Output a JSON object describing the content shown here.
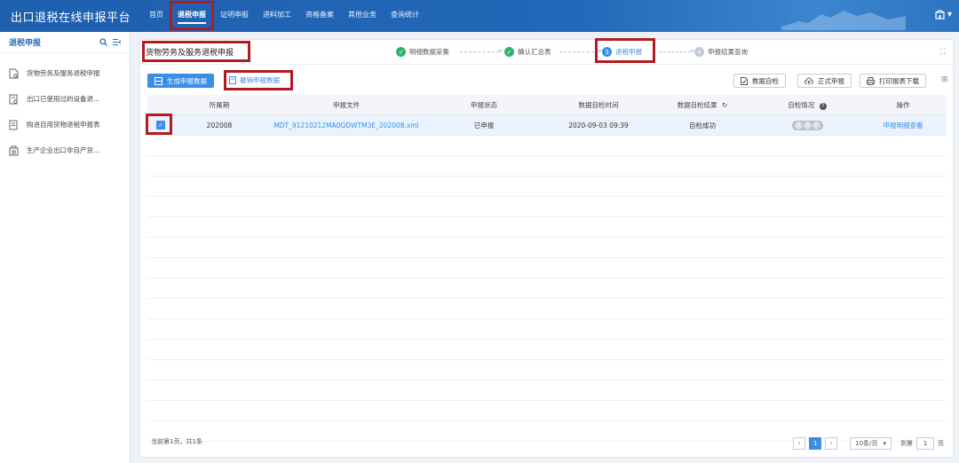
{
  "app": {
    "title": "出口退税在线申报平台"
  },
  "nav": {
    "items": [
      {
        "label": "首页"
      },
      {
        "label": "退税申报"
      },
      {
        "label": "证明申报"
      },
      {
        "label": "进料加工"
      },
      {
        "label": "资格备案"
      },
      {
        "label": "其他业务"
      },
      {
        "label": "查询统计"
      }
    ],
    "active_index": 1
  },
  "sidebar": {
    "title": "退税申报",
    "items": [
      {
        "label": "货物劳务及服务退税申报"
      },
      {
        "label": "出口已使用过的设备退..."
      },
      {
        "label": "购进自用货物退税申报表"
      },
      {
        "label": "生产企业出口非自产货..."
      }
    ]
  },
  "page": {
    "title": "货物劳务及服务退税申报",
    "steps": [
      {
        "label": "明细数据采集",
        "state": "done",
        "num": "1"
      },
      {
        "label": "确认汇总表",
        "state": "done",
        "num": "2"
      },
      {
        "label": "退税申报",
        "state": "current",
        "num": "3"
      },
      {
        "label": "申报结果查询",
        "state": "todo",
        "num": "4"
      }
    ]
  },
  "toolbar": {
    "generate_label": "生成申报数据",
    "revoke_label": "撤销申报数据",
    "self_check_label": "数据自检",
    "formal_label": "正式申报",
    "print_label": "打印报表下载"
  },
  "table": {
    "headers": [
      "所属期",
      "申报文件",
      "申报状态",
      "数据自检时间",
      "数据自检结果",
      "自检情况",
      "操作"
    ],
    "rows": [
      {
        "period": "202008",
        "file": "MDT_91210212MA0QDWTM3E_202008.xml",
        "status": "已申报",
        "check_time": "2020-09-03 09:39",
        "check_result": "自检成功",
        "check_counts": [
          "0",
          "0",
          "0"
        ],
        "action": "申报明细查看"
      }
    ]
  },
  "footer": {
    "info": "当前第1页，共1条",
    "current_page": "1",
    "page_size": "10条/页",
    "goto_label": "到第",
    "goto_value": "1",
    "page_unit": "页"
  },
  "colors": {
    "accent": "#3b8ee6",
    "success": "#2fb36b",
    "highlight": "#b01c22"
  }
}
